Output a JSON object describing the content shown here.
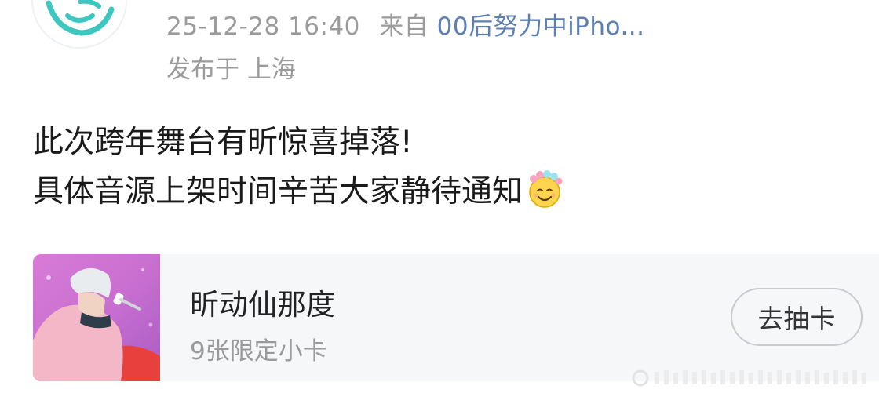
{
  "post": {
    "datetime": "25-12-28 16:40",
    "source_prefix": "来自",
    "source_name": "00后努力中iPho...",
    "location": "发布于 上海",
    "text_line1": "此次跨年舞台有昕惊喜掉落!",
    "text_line2": "具体音源上架时间辛苦大家静待通知",
    "emoji_icon": "flower-halo-smile-icon"
  },
  "card": {
    "title": "昕动仙那度",
    "subtitle": "9张限定小卡",
    "button_label": "去抽卡",
    "thumbnail": "performer-photo"
  },
  "colors": {
    "meta_gray": "#9b9b9b",
    "link_blue": "#5b7fb3",
    "card_bg": "#f6f7f9",
    "avatar_accent": "#3ec7c0"
  }
}
